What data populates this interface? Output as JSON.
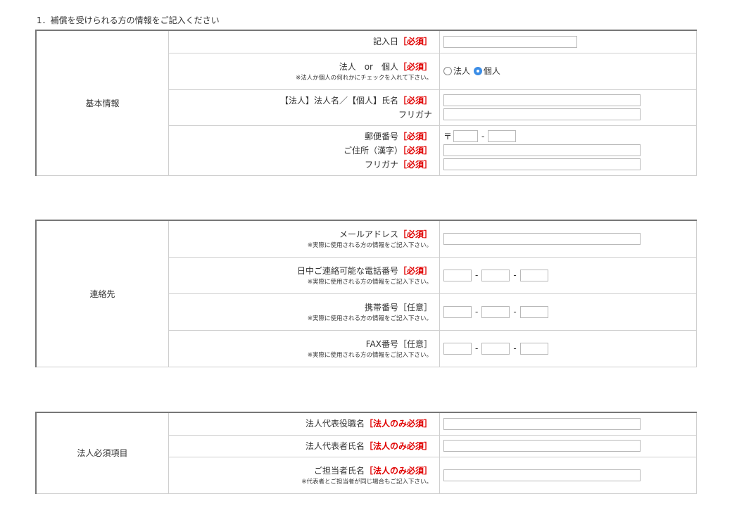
{
  "heading": "1．補償を受けられる方の情報をご記入ください",
  "sections": {
    "basic": {
      "title": "基本情報",
      "date_label": "記入日",
      "entity_label": "法人　or　個人",
      "entity_note": "※法人か個人の何れかにチェックを入れて下さい。",
      "radio_corp": "法人",
      "radio_person": "個人",
      "name_label": "【法人】法人名／【個人】氏名",
      "furigana": "フリガナ",
      "postal_label": "郵便番号",
      "postal_mark": "〒",
      "address_label": "ご住所（漢字）",
      "address_furigana": "フリガナ"
    },
    "contact": {
      "title": "連絡先",
      "email_label": "メールアドレス",
      "day_phone_label": "日中ご連絡可能な電話番号",
      "mobile_label": "携帯番号",
      "fax_label": "FAX番号",
      "note": "※実際に使用される方の情報をご記入下さい。"
    },
    "corp": {
      "title": "法人必須項目",
      "rep_title_label": "法人代表役職名",
      "rep_name_label": "法人代表者氏名",
      "staff_label": "ご担当者氏名",
      "staff_note": "※代表者とご担当者が同じ場合もご記入下さい。"
    }
  },
  "tags": {
    "required": "［必須］",
    "optional": "［任意］",
    "corp_required": "［法人のみ必須］"
  },
  "dash": "-",
  "selected_entity": "個人"
}
